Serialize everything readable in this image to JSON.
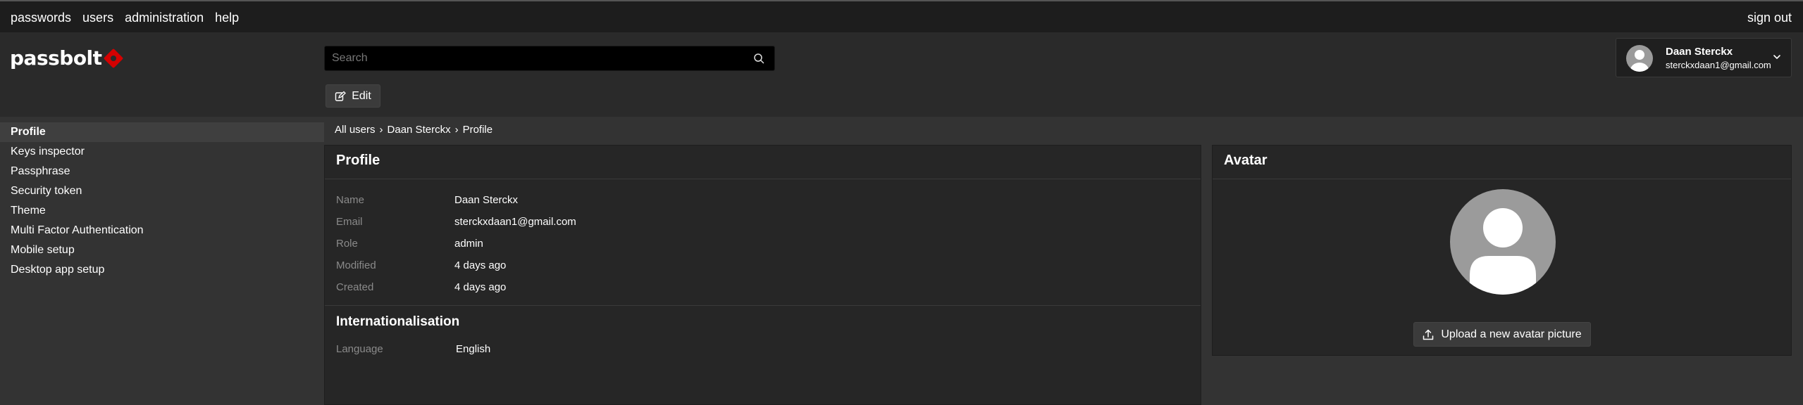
{
  "topnav": {
    "items": [
      "passwords",
      "users",
      "administration",
      "help"
    ],
    "sign_out": "sign out"
  },
  "header": {
    "logo": "passbolt",
    "search_placeholder": "Search",
    "edit_label": "Edit",
    "user": {
      "name": "Daan Sterckx",
      "email": "sterckxdaan1@gmail.com"
    }
  },
  "sidebar": {
    "items": [
      {
        "label": "Profile",
        "active": true
      },
      {
        "label": "Keys inspector"
      },
      {
        "label": "Passphrase"
      },
      {
        "label": "Security token"
      },
      {
        "label": "Theme"
      },
      {
        "label": "Multi Factor Authentication"
      },
      {
        "label": "Mobile setup"
      },
      {
        "label": "Desktop app setup"
      }
    ]
  },
  "breadcrumb": [
    "All users",
    "Daan Sterckx",
    "Profile"
  ],
  "profile": {
    "title": "Profile",
    "fields": [
      {
        "key": "Name",
        "value": "Daan Sterckx"
      },
      {
        "key": "Email",
        "value": "sterckxdaan1@gmail.com"
      },
      {
        "key": "Role",
        "value": "admin"
      },
      {
        "key": "Modified",
        "value": "4 days ago"
      },
      {
        "key": "Created",
        "value": "4 days ago"
      }
    ],
    "internationalisation": {
      "title": "Internationalisation",
      "language_key": "Language",
      "language_value": "English"
    }
  },
  "avatar": {
    "title": "Avatar",
    "upload_label": "Upload a new avatar picture"
  },
  "colors": {
    "brand_red": "#d40101",
    "topbar_bg": "#1d1d1d",
    "panel_bg": "#262626"
  }
}
